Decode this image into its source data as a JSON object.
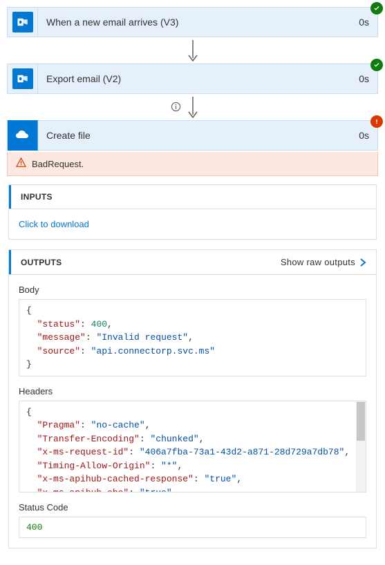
{
  "steps": {
    "step1": {
      "title": "When a new email arrives (V3)",
      "duration": "0s",
      "status": "success"
    },
    "step2": {
      "title": "Export email (V2)",
      "duration": "0s",
      "status": "success"
    },
    "step3": {
      "title": "Create file",
      "duration": "0s",
      "status": "error"
    }
  },
  "error": {
    "message": "BadRequest."
  },
  "inputs": {
    "header": "INPUTS",
    "download_link": "Click to download"
  },
  "outputs": {
    "header": "OUTPUTS",
    "show_raw_label": "Show raw outputs",
    "body_label": "Body",
    "headers_label": "Headers",
    "status_label": "Status Code",
    "body": {
      "status": 400,
      "message": "Invalid request",
      "source": "api.connectorp.svc.ms"
    },
    "headers": {
      "Pragma": "no-cache",
      "Transfer-Encoding": "chunked",
      "x-ms-request-id": "406a7fba-73a1-43d2-a871-28d729a7db78",
      "Timing-Allow-Origin": "*",
      "x-ms-apihub-cached-response": "true",
      "x-ms-apihub-obo": "true"
    },
    "status_code": "400"
  }
}
